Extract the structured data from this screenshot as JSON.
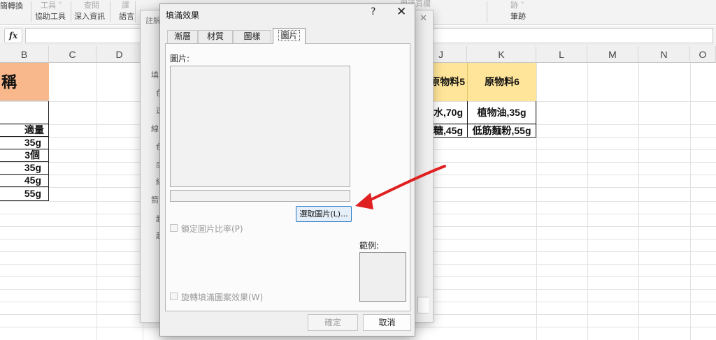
{
  "ribbon": {
    "items": [
      "簡轉換",
      "協助工具",
      "深入資訊",
      "語言",
      "筆跡"
    ],
    "dim_items": [
      "工具 ˅",
      "查閱",
      "譯",
      "註冊",
      "用活頁欄",
      "跡 ˅"
    ]
  },
  "formula_bar": {
    "fx": "fx",
    "value": ""
  },
  "sheet": {
    "columns": [
      "B",
      "C",
      "D",
      "J",
      "K",
      "L",
      "M",
      "N",
      "O"
    ],
    "b_header": "稱",
    "b_values": [
      "適量",
      "35g",
      "3個",
      "35g",
      "45g",
      "55g"
    ],
    "j_header": "原物料5",
    "k_header": "原物料6",
    "j_values": [
      "水,70g",
      "糖,45g"
    ],
    "k_values": [
      "植物油,35g",
      "低筋麵粉,55g"
    ],
    "header_fill_b": "#f8b88b",
    "header_fill_jk": "#ffe599"
  },
  "background_dialog": {
    "title": "註解",
    "labels": [
      "填",
      "色",
      "透",
      "線",
      "色",
      "虛",
      "線",
      "箭",
      "起",
      "起"
    ]
  },
  "dialog": {
    "title": "填滿效果",
    "help": "?",
    "close": "✕",
    "tabs": [
      "漸層",
      "材質",
      "圖樣",
      "圖片"
    ],
    "active_tab": "圖片",
    "picture_label": "圖片:",
    "select_picture_button": "選取圖片(L)...",
    "lock_ratio_label": "鎖定圖片比率(P)",
    "rotate_label": "旋轉填滿圖案效果(W)",
    "sample_label": "範例:",
    "ok_button": "確定",
    "cancel_button": "取消"
  },
  "annotation": {
    "arrow_color": "#e02020"
  }
}
